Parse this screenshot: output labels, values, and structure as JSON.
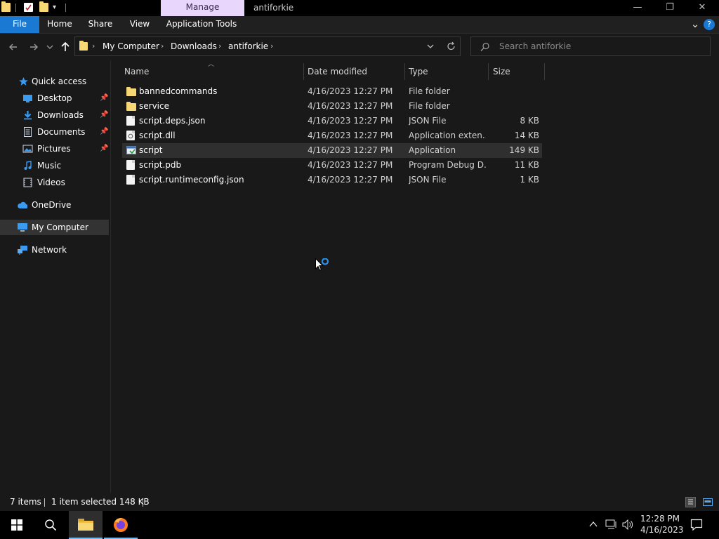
{
  "window": {
    "title": "antiforkie",
    "contextual_tab": "Manage",
    "minimize_glyph": "—",
    "restore_glyph": "❐",
    "close_glyph": "✕"
  },
  "ribbon": {
    "tabs": [
      "File",
      "Home",
      "Share",
      "View",
      "Application Tools"
    ],
    "expand_glyph": "⌄",
    "help_glyph": "?"
  },
  "address": {
    "crumbs": [
      "My Computer",
      "Downloads",
      "antiforkie"
    ],
    "search_placeholder": "Search antiforkie"
  },
  "nav": {
    "quick_access": "Quick access",
    "items": [
      {
        "label": "Desktop",
        "icon": "desktop-icon",
        "pinned": true
      },
      {
        "label": "Downloads",
        "icon": "downloads-icon",
        "pinned": true
      },
      {
        "label": "Documents",
        "icon": "documents-icon",
        "pinned": true
      },
      {
        "label": "Pictures",
        "icon": "pictures-icon",
        "pinned": true
      },
      {
        "label": "Music",
        "icon": "music-icon",
        "pinned": false
      },
      {
        "label": "Videos",
        "icon": "videos-icon",
        "pinned": false
      }
    ],
    "onedrive": "OneDrive",
    "my_computer": "My Computer",
    "network": "Network"
  },
  "columns": {
    "name": "Name",
    "date": "Date modified",
    "type": "Type",
    "size": "Size"
  },
  "files": [
    {
      "name": "bannedcommands",
      "date": "4/16/2023 12:27 PM",
      "type": "File folder",
      "size": "",
      "icon": "folder-icon",
      "selected": false
    },
    {
      "name": "service",
      "date": "4/16/2023 12:27 PM",
      "type": "File folder",
      "size": "",
      "icon": "folder-icon",
      "selected": false
    },
    {
      "name": "script.deps.json",
      "date": "4/16/2023 12:27 PM",
      "type": "JSON File",
      "size": "8 KB",
      "icon": "json-file-icon",
      "selected": false
    },
    {
      "name": "script.dll",
      "date": "4/16/2023 12:27 PM",
      "type": "Application exten...",
      "size": "14 KB",
      "icon": "dll-file-icon",
      "selected": false
    },
    {
      "name": "script",
      "date": "4/16/2023 12:27 PM",
      "type": "Application",
      "size": "149 KB",
      "icon": "application-icon",
      "selected": true
    },
    {
      "name": "script.pdb",
      "date": "4/16/2023 12:27 PM",
      "type": "Program Debug D...",
      "size": "11 KB",
      "icon": "pdb-file-icon",
      "selected": false
    },
    {
      "name": "script.runtimeconfig.json",
      "date": "4/16/2023 12:27 PM",
      "type": "JSON File",
      "size": "1 KB",
      "icon": "json-file-icon",
      "selected": false
    }
  ],
  "status": {
    "items": "7 items",
    "selection": "1 item selected  148 KB"
  },
  "taskbar": {
    "time": "12:28 PM",
    "date": "4/16/2023"
  },
  "colors": {
    "accent": "#1a7ad3",
    "folder": "#f8d775",
    "manage_tab": "#e8d6fc",
    "selection": "#2f2f2f"
  }
}
